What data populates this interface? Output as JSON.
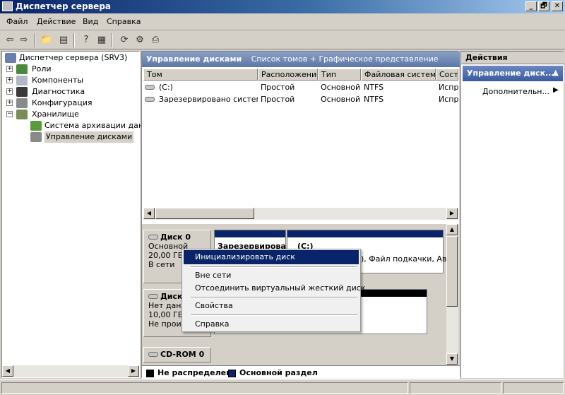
{
  "window": {
    "title": "Диспетчер сервера",
    "controls": {
      "minimize": "_",
      "restore": "🗗",
      "close": "✕"
    }
  },
  "menu": [
    "Файл",
    "Действие",
    "Вид",
    "Справка"
  ],
  "toolbar": {
    "icons": [
      "back-icon",
      "forward-icon",
      "up-folder-icon",
      "show-hide-tree-icon",
      "help-icon",
      "properties-icon",
      "refresh-icon",
      "settings-icon",
      "export-icon"
    ]
  },
  "tree": {
    "root": "Диспетчер сервера (SRV3)",
    "items": [
      {
        "label": "Роли",
        "expander": "+"
      },
      {
        "label": "Компоненты",
        "expander": "+"
      },
      {
        "label": "Диагностика",
        "expander": "+"
      },
      {
        "label": "Конфигурация",
        "expander": "+"
      },
      {
        "label": "Хранилище",
        "expander": "−"
      }
    ],
    "children": [
      {
        "label": "Система архивации данн"
      },
      {
        "label": "Управление дисками"
      }
    ]
  },
  "center": {
    "header_title": "Управление дисками",
    "header_subtitle": "Список томов + Графическое представление",
    "columns": [
      "Том",
      "Расположение",
      "Тип",
      "Файловая система",
      "Состо"
    ],
    "volumes": [
      {
        "name": "(C:)",
        "location": "Простой",
        "type": "Основной",
        "fs": "NTFS",
        "status": "Испра"
      },
      {
        "name": "Зарезервировано системой",
        "location": "Простой",
        "type": "Основной",
        "fs": "NTFS",
        "status": "Испра"
      }
    ]
  },
  "disks": [
    {
      "name": "Диск 0",
      "type": "Основной",
      "size": "20,00 ГБ",
      "state": "В сети",
      "partitions": [
        {
          "label": "Зарезервирова"
        },
        {
          "label": "(C:)",
          "detail": "), Файл подкачки, Ава"
        }
      ]
    },
    {
      "name": "Диск",
      "type": "Нет данн",
      "size": "10,00 ГБ",
      "state": "Не проин"
    },
    {
      "name": "CD-ROM 0"
    }
  ],
  "legend": {
    "items": [
      {
        "label": "Не распределен",
        "color": "#000000"
      },
      {
        "label": "Основной раздел",
        "color": "#0a246a"
      }
    ]
  },
  "actions": {
    "header": "Действия",
    "section": "Управление диск...",
    "item": "Дополнительн..."
  },
  "context_menu": {
    "items": [
      "Инициализировать диск",
      "Вне сети",
      "Отсоединить виртуальный жесткий диск",
      "Свойства",
      "Справка"
    ],
    "selected": "Инициализировать диск"
  }
}
